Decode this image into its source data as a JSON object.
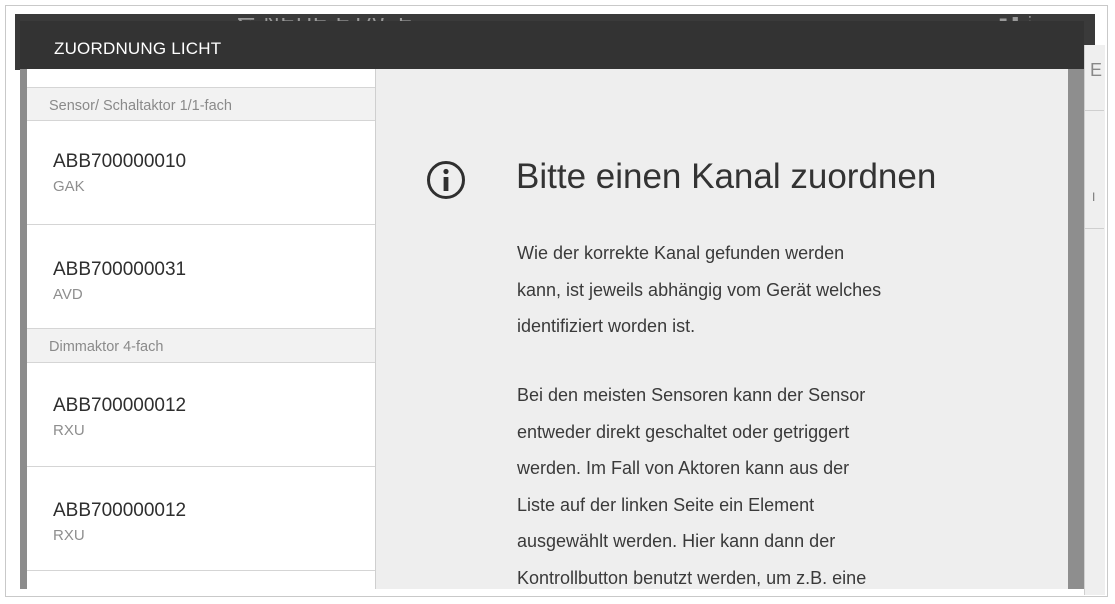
{
  "background_app": {
    "title": "NEUE ETAGE",
    "title_prefix_icon": "arrows-icon",
    "right_panel_glyphs": [
      "E",
      "I"
    ]
  },
  "dialog": {
    "title": "ZUORDNUNG LICHT",
    "groups": [
      {
        "header": "Sensor/ Schaltaktor 1/1-fach",
        "items": [
          {
            "id": "ABB700000010",
            "sub": "GAK"
          },
          {
            "id": "ABB700000031",
            "sub": "AVD"
          }
        ]
      },
      {
        "header": "Dimmaktor 4-fach",
        "items": [
          {
            "id": "ABB700000012",
            "sub": "RXU"
          },
          {
            "id": "ABB700000012",
            "sub": "RXU"
          }
        ]
      }
    ],
    "main": {
      "icon": "info-icon",
      "title": "Bitte einen Kanal zuordnen",
      "paragraph1_lines": [
        "Wie der korrekte Kanal gefunden werden",
        "kann, ist jeweils abhängig vom Gerät welches",
        "identifiziert worden ist."
      ],
      "paragraph2_lines": [
        "Bei den meisten Sensoren kann der Sensor",
        "entweder direkt geschaltet oder getriggert",
        "werden. Im Fall von Aktoren kann aus der",
        "Liste auf der linken Seite ein Element",
        "ausgewählt werden. Hier kann dann der",
        "Kontrollbutton benutzt werden, um z.B. eine"
      ]
    }
  },
  "colors": {
    "header_bg": "#333333",
    "main_bg": "#eeeeee",
    "scrollbar": "#8e8e8e"
  }
}
